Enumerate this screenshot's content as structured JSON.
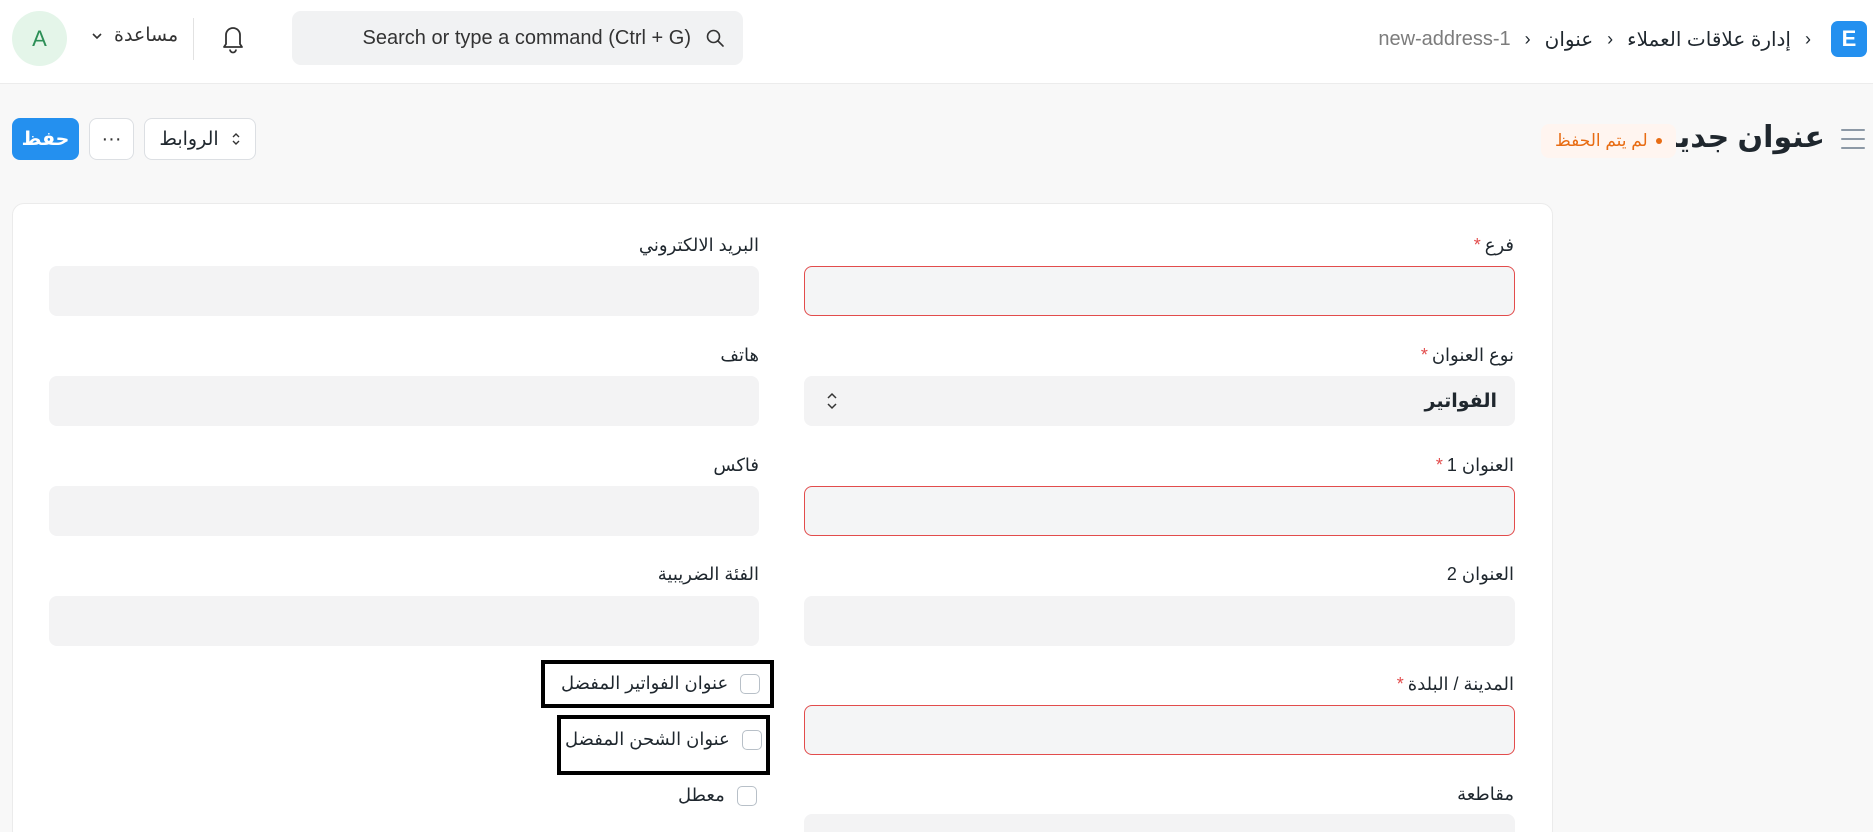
{
  "navbar": {
    "logo_letter": "E",
    "breadcrumb": [
      "إدارة علاقات العملاء",
      "عنوان",
      "new-address-1"
    ],
    "search_placeholder": "Search or type a command (Ctrl + G)",
    "help_label": "مساعدة",
    "avatar_letter": "A"
  },
  "page": {
    "title": "عنوان جديد",
    "status": "لم يتم الحفظ",
    "save_label": "حفظ",
    "more_label": "···",
    "links_label": "الروابط"
  },
  "form": {
    "branch_label": "فرع",
    "address_type_label": "نوع العنوان",
    "address_type_value": "الفواتير",
    "address1_label": "العنوان 1",
    "address2_label": "العنوان 2",
    "city_label": "المدينة / البلدة",
    "county_label": "مقاطعة",
    "email_label": "البريد الالكتروني",
    "phone_label": "هاتف",
    "fax_label": "فاكس",
    "tax_category_label": "الفئة الضريبية",
    "preferred_billing_label": "عنوان الفواتير المفضل",
    "preferred_shipping_label": "عنوان الشحن المفضل",
    "disabled_label": "معطل",
    "required_mark": "*"
  },
  "colors": {
    "primary": "#2490ef",
    "required": "#e24c4c",
    "status_text": "#e86c13",
    "status_bg": "#fff5f0"
  }
}
